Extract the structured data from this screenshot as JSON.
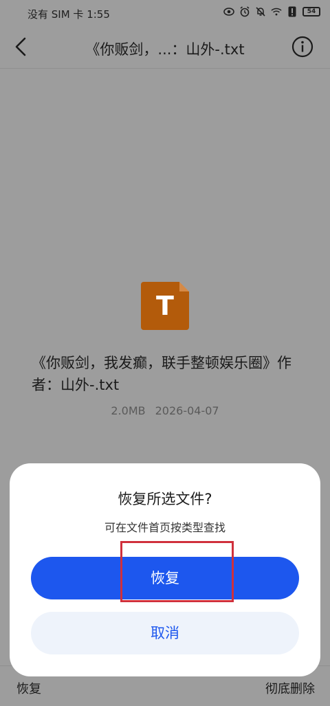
{
  "status_bar": {
    "carrier_time": "没有 SIM 卡 1:55",
    "battery": "54",
    "icons": [
      "eye-icon",
      "alarm-icon",
      "bell-muted-icon",
      "wifi-icon",
      "alert-icon",
      "battery-icon"
    ]
  },
  "header": {
    "title": "《你贩剑，...：山外-.txt",
    "back_icon": "chevron-left-icon",
    "info_icon": "info-icon"
  },
  "file": {
    "icon_letter": "T",
    "icon_color": "#b35b0b",
    "name": "《你贩剑，我发癫，联手整顿娱乐圈》作者：山外-.txt",
    "size": "2.0MB",
    "date": "2026-04-07"
  },
  "bottom_bar": {
    "restore_label": "恢复",
    "delete_label": "彻底删除"
  },
  "dialog": {
    "title": "恢复所选文件?",
    "subtitle": "可在文件首页按类型查找",
    "confirm_label": "恢复",
    "cancel_label": "取消",
    "accent_color": "#1d57ee"
  },
  "annotation": {
    "highlight_color": "#d0303c"
  }
}
